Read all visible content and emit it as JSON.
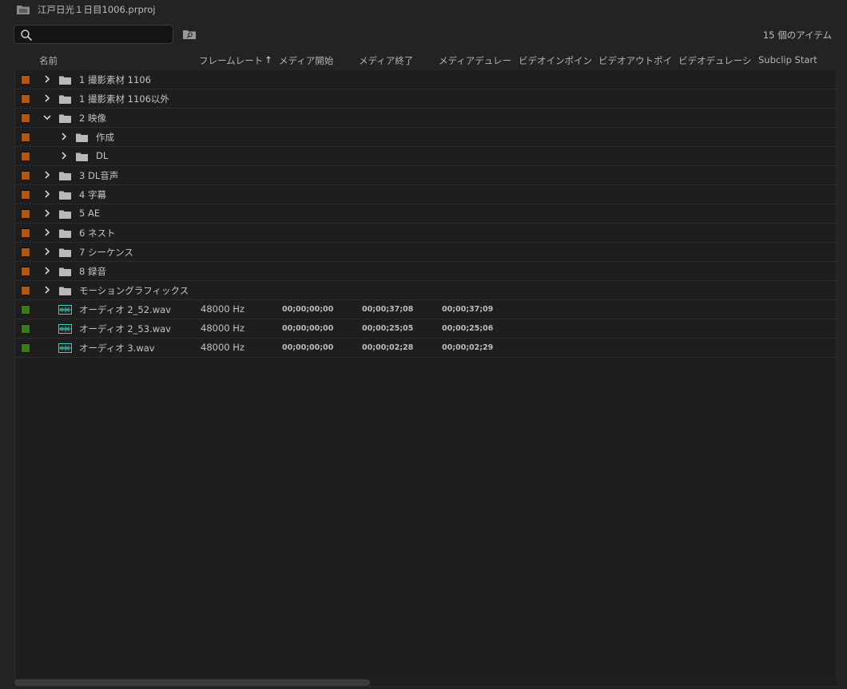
{
  "title": "江戸日光１日目1006.prproj",
  "search": {
    "value": "",
    "placeholder": ""
  },
  "item_count": "15 個のアイテム",
  "columns": [
    "名前",
    "フレームレート",
    "メディア開始",
    "メディア終了",
    "メディアデュレー",
    "ビデオインポイン",
    "ビデオアウトポイ",
    "ビデオデュレーシ",
    "Subclip Start"
  ],
  "sort_indicator": "↑",
  "colors": {
    "folder_label": "#b5560e",
    "audio_label": "#3a7a1c",
    "wav_icon": "#3fd0c0"
  },
  "rows": [
    {
      "type": "folder",
      "label": "1 撮影素材 1106",
      "expanded": false,
      "indent": 0
    },
    {
      "type": "folder",
      "label": "1 撮影素材 1106以外",
      "expanded": false,
      "indent": 0
    },
    {
      "type": "folder",
      "label": "2 映像",
      "expanded": true,
      "indent": 0
    },
    {
      "type": "folder",
      "label": "作成",
      "expanded": false,
      "indent": 1
    },
    {
      "type": "folder",
      "label": "DL",
      "expanded": false,
      "indent": 1
    },
    {
      "type": "folder",
      "label": "3 DL音声",
      "expanded": false,
      "indent": 0
    },
    {
      "type": "folder",
      "label": "4 字幕",
      "expanded": false,
      "indent": 0
    },
    {
      "type": "folder",
      "label": "5 AE",
      "expanded": false,
      "indent": 0
    },
    {
      "type": "folder",
      "label": "6 ネスト",
      "expanded": false,
      "indent": 0
    },
    {
      "type": "folder",
      "label": "7 シーケンス",
      "expanded": false,
      "indent": 0
    },
    {
      "type": "folder",
      "label": "8 録音",
      "expanded": false,
      "indent": 0
    },
    {
      "type": "folder",
      "label": "モーショングラフィックス",
      "expanded": false,
      "indent": 0
    },
    {
      "type": "audio",
      "label": "オーディオ 2_52.wav",
      "rate": "48000 Hz",
      "start": "00;00;00;00",
      "end": "00;00;37;08",
      "duration": "00;00;37;09"
    },
    {
      "type": "audio",
      "label": "オーディオ 2_53.wav",
      "rate": "48000 Hz",
      "start": "00;00;00;00",
      "end": "00;00;25;05",
      "duration": "00;00;25;06"
    },
    {
      "type": "audio",
      "label": "オーディオ 3.wav",
      "rate": "48000 Hz",
      "start": "00;00;00;00",
      "end": "00;00;02;28",
      "duration": "00;00;02;29"
    }
  ],
  "icons": [
    "project-icon",
    "search-icon",
    "new-bin-icon",
    "chevron-right-icon",
    "chevron-down-icon",
    "folder-icon",
    "audio-waveform-icon"
  ]
}
